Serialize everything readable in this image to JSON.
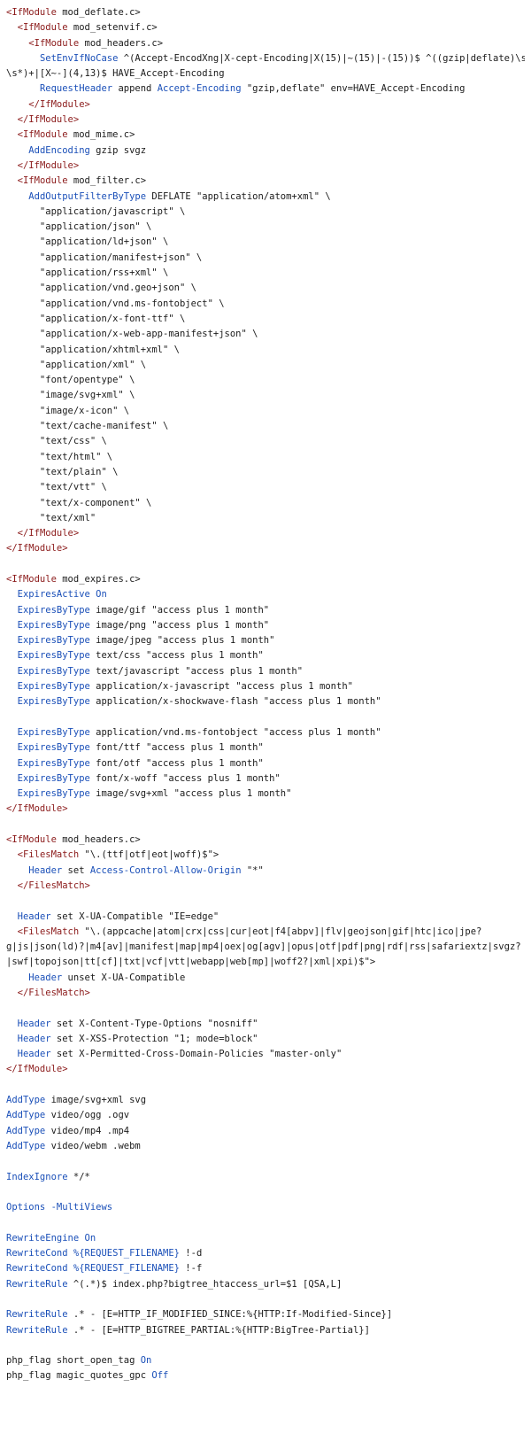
{
  "document": {
    "lines": [
      [
        [
          "t",
          "<IfModule"
        ],
        [
          "p",
          " mod_deflate.c>"
        ]
      ],
      [
        [
          "p",
          "  "
        ],
        [
          "t",
          "<IfModule"
        ],
        [
          "p",
          " mod_setenvif.c>"
        ]
      ],
      [
        [
          "p",
          "    "
        ],
        [
          "t",
          "<IfModule"
        ],
        [
          "p",
          " mod_headers.c>"
        ]
      ],
      [
        [
          "p",
          "      "
        ],
        [
          "d",
          "SetEnvIfNoCase"
        ],
        [
          "p",
          " ^(Accept-EncodXng|X-cept-Encoding|X(15)|~(15)|-(15))$ ^((gzip|deflate)\\s*,?"
        ]
      ],
      [
        [
          "p",
          "\\s*)+|[X~-](4,13)$ HAVE_Accept-Encoding"
        ]
      ],
      [
        [
          "p",
          "      "
        ],
        [
          "d",
          "RequestHeader"
        ],
        [
          "p",
          " append "
        ],
        [
          "d",
          "Accept-Encoding"
        ],
        [
          "p",
          " \"gzip,deflate\" env=HAVE_Accept-Encoding"
        ]
      ],
      [
        [
          "p",
          "    "
        ],
        [
          "t",
          "</IfModule>"
        ]
      ],
      [
        [
          "p",
          "  "
        ],
        [
          "t",
          "</IfModule>"
        ]
      ],
      [
        [
          "p",
          "  "
        ],
        [
          "t",
          "<IfModule"
        ],
        [
          "p",
          " mod_mime.c>"
        ]
      ],
      [
        [
          "p",
          "    "
        ],
        [
          "d",
          "AddEncoding"
        ],
        [
          "p",
          " gzip svgz"
        ]
      ],
      [
        [
          "p",
          "  "
        ],
        [
          "t",
          "</IfModule>"
        ]
      ],
      [
        [
          "p",
          "  "
        ],
        [
          "t",
          "<IfModule"
        ],
        [
          "p",
          " mod_filter.c>"
        ]
      ],
      [
        [
          "p",
          "    "
        ],
        [
          "d",
          "AddOutputFilterByType"
        ],
        [
          "p",
          " DEFLATE \"application/atom+xml\" \\"
        ]
      ],
      [
        [
          "p",
          "      \"application/javascript\" \\"
        ]
      ],
      [
        [
          "p",
          "      \"application/json\" \\"
        ]
      ],
      [
        [
          "p",
          "      \"application/ld+json\" \\"
        ]
      ],
      [
        [
          "p",
          "      \"application/manifest+json\" \\"
        ]
      ],
      [
        [
          "p",
          "      \"application/rss+xml\" \\"
        ]
      ],
      [
        [
          "p",
          "      \"application/vnd.geo+json\" \\"
        ]
      ],
      [
        [
          "p",
          "      \"application/vnd.ms-fontobject\" \\"
        ]
      ],
      [
        [
          "p",
          "      \"application/x-font-ttf\" \\"
        ]
      ],
      [
        [
          "p",
          "      \"application/x-web-app-manifest+json\" \\"
        ]
      ],
      [
        [
          "p",
          "      \"application/xhtml+xml\" \\"
        ]
      ],
      [
        [
          "p",
          "      \"application/xml\" \\"
        ]
      ],
      [
        [
          "p",
          "      \"font/opentype\" \\"
        ]
      ],
      [
        [
          "p",
          "      \"image/svg+xml\" \\"
        ]
      ],
      [
        [
          "p",
          "      \"image/x-icon\" \\"
        ]
      ],
      [
        [
          "p",
          "      \"text/cache-manifest\" \\"
        ]
      ],
      [
        [
          "p",
          "      \"text/css\" \\"
        ]
      ],
      [
        [
          "p",
          "      \"text/html\" \\"
        ]
      ],
      [
        [
          "p",
          "      \"text/plain\" \\"
        ]
      ],
      [
        [
          "p",
          "      \"text/vtt\" \\"
        ]
      ],
      [
        [
          "p",
          "      \"text/x-component\" \\"
        ]
      ],
      [
        [
          "p",
          "      \"text/xml\""
        ]
      ],
      [
        [
          "p",
          "  "
        ],
        [
          "t",
          "</IfModule>"
        ]
      ],
      [
        [
          "t",
          "</IfModule>"
        ]
      ],
      [],
      [
        [
          "t",
          "<IfModule"
        ],
        [
          "p",
          " mod_expires.c>"
        ]
      ],
      [
        [
          "p",
          "  "
        ],
        [
          "d",
          "ExpiresActive"
        ],
        [
          "p",
          " "
        ],
        [
          "d",
          "On"
        ]
      ],
      [
        [
          "p",
          "  "
        ],
        [
          "d",
          "ExpiresByType"
        ],
        [
          "p",
          " image/gif \"access plus 1 month\""
        ]
      ],
      [
        [
          "p",
          "  "
        ],
        [
          "d",
          "ExpiresByType"
        ],
        [
          "p",
          " image/png \"access plus 1 month\""
        ]
      ],
      [
        [
          "p",
          "  "
        ],
        [
          "d",
          "ExpiresByType"
        ],
        [
          "p",
          " image/jpeg \"access plus 1 month\""
        ]
      ],
      [
        [
          "p",
          "  "
        ],
        [
          "d",
          "ExpiresByType"
        ],
        [
          "p",
          " text/css \"access plus 1 month\""
        ]
      ],
      [
        [
          "p",
          "  "
        ],
        [
          "d",
          "ExpiresByType"
        ],
        [
          "p",
          " text/javascript \"access plus 1 month\""
        ]
      ],
      [
        [
          "p",
          "  "
        ],
        [
          "d",
          "ExpiresByType"
        ],
        [
          "p",
          " application/x-javascript \"access plus 1 month\""
        ]
      ],
      [
        [
          "p",
          "  "
        ],
        [
          "d",
          "ExpiresByType"
        ],
        [
          "p",
          " application/x-shockwave-flash \"access plus 1 month\""
        ]
      ],
      [],
      [
        [
          "p",
          "  "
        ],
        [
          "d",
          "ExpiresByType"
        ],
        [
          "p",
          " application/vnd.ms-fontobject \"access plus 1 month\""
        ]
      ],
      [
        [
          "p",
          "  "
        ],
        [
          "d",
          "ExpiresByType"
        ],
        [
          "p",
          " font/ttf \"access plus 1 month\""
        ]
      ],
      [
        [
          "p",
          "  "
        ],
        [
          "d",
          "ExpiresByType"
        ],
        [
          "p",
          " font/otf \"access plus 1 month\""
        ]
      ],
      [
        [
          "p",
          "  "
        ],
        [
          "d",
          "ExpiresByType"
        ],
        [
          "p",
          " font/x-woff \"access plus 1 month\""
        ]
      ],
      [
        [
          "p",
          "  "
        ],
        [
          "d",
          "ExpiresByType"
        ],
        [
          "p",
          " image/svg+xml \"access plus 1 month\""
        ]
      ],
      [
        [
          "t",
          "</IfModule>"
        ]
      ],
      [],
      [
        [
          "t",
          "<IfModule"
        ],
        [
          "p",
          " mod_headers.c>"
        ]
      ],
      [
        [
          "p",
          "  "
        ],
        [
          "t",
          "<FilesMatch"
        ],
        [
          "p",
          " \"\\.(ttf|otf|eot|woff)$\">"
        ]
      ],
      [
        [
          "p",
          "    "
        ],
        [
          "d",
          "Header"
        ],
        [
          "p",
          " set "
        ],
        [
          "d",
          "Access-Control-Allow-Origin"
        ],
        [
          "p",
          " \"*\""
        ]
      ],
      [
        [
          "p",
          "  "
        ],
        [
          "t",
          "</FilesMatch>"
        ]
      ],
      [],
      [
        [
          "p",
          "  "
        ],
        [
          "d",
          "Header"
        ],
        [
          "p",
          " set X-UA-Compatible \"IE=edge\""
        ]
      ],
      [
        [
          "p",
          "  "
        ],
        [
          "t",
          "<FilesMatch"
        ],
        [
          "p",
          " \"\\.(appcache|atom|crx|css|cur|eot|f4[abpv]|flv|geojson|gif|htc|ico|jpe?"
        ]
      ],
      [
        [
          "p",
          "g|js|json(ld)?|m4[av]|manifest|map|mp4|oex|og[agv]|opus|otf|pdf|png|rdf|rss|safariextz|svgz?"
        ]
      ],
      [
        [
          "p",
          "|swf|topojson|tt[cf]|txt|vcf|vtt|webapp|web[mp]|woff2?|xml|xpi)$\">"
        ]
      ],
      [
        [
          "p",
          "    "
        ],
        [
          "d",
          "Header"
        ],
        [
          "p",
          " unset X-UA-Compatible"
        ]
      ],
      [
        [
          "p",
          "  "
        ],
        [
          "t",
          "</FilesMatch>"
        ]
      ],
      [],
      [
        [
          "p",
          "  "
        ],
        [
          "d",
          "Header"
        ],
        [
          "p",
          " set X-Content-Type-Options \"nosniff\""
        ]
      ],
      [
        [
          "p",
          "  "
        ],
        [
          "d",
          "Header"
        ],
        [
          "p",
          " set X-XSS-Protection \"1; mode=block\""
        ]
      ],
      [
        [
          "p",
          "  "
        ],
        [
          "d",
          "Header"
        ],
        [
          "p",
          " set X-Permitted-Cross-Domain-Policies \"master-only\""
        ]
      ],
      [
        [
          "t",
          "</IfModule>"
        ]
      ],
      [],
      [
        [
          "d",
          "AddType"
        ],
        [
          "p",
          " image/svg+xml svg"
        ]
      ],
      [
        [
          "d",
          "AddType"
        ],
        [
          "p",
          " video/ogg .ogv"
        ]
      ],
      [
        [
          "d",
          "AddType"
        ],
        [
          "p",
          " video/mp4 .mp4"
        ]
      ],
      [
        [
          "d",
          "AddType"
        ],
        [
          "p",
          " video/webm .webm"
        ]
      ],
      [],
      [
        [
          "d",
          "IndexIgnore"
        ],
        [
          "p",
          " */*"
        ]
      ],
      [],
      [
        [
          "d",
          "Options"
        ],
        [
          "p",
          " "
        ],
        [
          "d",
          "-MultiViews"
        ]
      ],
      [],
      [
        [
          "d",
          "RewriteEngine"
        ],
        [
          "p",
          " "
        ],
        [
          "d",
          "On"
        ]
      ],
      [
        [
          "d",
          "RewriteCond"
        ],
        [
          "p",
          " "
        ],
        [
          "d",
          "%{REQUEST_FILENAME}"
        ],
        [
          "p",
          " !-d"
        ]
      ],
      [
        [
          "d",
          "RewriteCond"
        ],
        [
          "p",
          " "
        ],
        [
          "d",
          "%{REQUEST_FILENAME}"
        ],
        [
          "p",
          " !-f"
        ]
      ],
      [
        [
          "d",
          "RewriteRule"
        ],
        [
          "p",
          " ^(.*)$ index.php?bigtree_htaccess_url=$1 [QSA,L]"
        ]
      ],
      [],
      [
        [
          "d",
          "RewriteRule"
        ],
        [
          "p",
          " .* - [E=HTTP_IF_MODIFIED_SINCE:%{HTTP:If-Modified-Since}]"
        ]
      ],
      [
        [
          "d",
          "RewriteRule"
        ],
        [
          "p",
          " .* - [E=HTTP_BIGTREE_PARTIAL:%{HTTP:BigTree-Partial}]"
        ]
      ],
      [],
      [
        [
          "p",
          "php_flag short_open_tag "
        ],
        [
          "d",
          "On"
        ]
      ],
      [
        [
          "p",
          "php_flag magic_quotes_gpc "
        ],
        [
          "d",
          "Off"
        ]
      ]
    ]
  },
  "colors": {
    "tag": "#8b1a1a",
    "directive": "#1a4fb8",
    "text": "#1a1a1a",
    "background": "#ffffff"
  }
}
